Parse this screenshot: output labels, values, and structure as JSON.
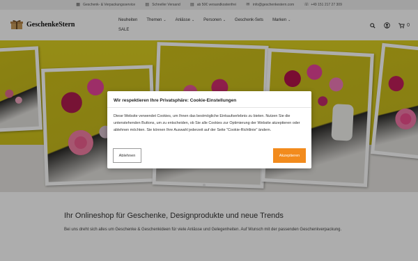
{
  "topbar": {
    "items": [
      {
        "icon": "gift-icon",
        "text": "Geschenk- & Verpackungsservice"
      },
      {
        "icon": "truck-icon",
        "text": "Schneller Versand"
      },
      {
        "icon": "truck-icon",
        "text": "ab 50€ versandkostenfrei"
      },
      {
        "icon": "mail-icon",
        "text": "info@geschenkestern.com"
      },
      {
        "icon": "phone-icon",
        "text": "+49 151 217 27 309"
      }
    ]
  },
  "header": {
    "logo_text": "GeschenkeStern",
    "nav": [
      {
        "label": "Neuheiten",
        "dropdown": false
      },
      {
        "label": "Themen",
        "dropdown": true
      },
      {
        "label": "Anlässe",
        "dropdown": true
      },
      {
        "label": "Personen",
        "dropdown": true
      },
      {
        "label": "Geschenk-Sets",
        "dropdown": false
      },
      {
        "label": "Marken",
        "dropdown": true
      },
      {
        "label": "SALE",
        "dropdown": false
      }
    ],
    "cart_count": "0",
    "icons": [
      "search-icon",
      "user-icon",
      "cart-icon"
    ]
  },
  "hero": {
    "slides": 2,
    "active_slide": 1
  },
  "intro": {
    "heading": "Ihr Onlineshop für Geschenke, Designprodukte und neue Trends",
    "text": "Bei uns dreht sich alles um Geschenke & Geschenkideen für viele Anlässe und Gelegenheiten. Auf Wunsch mit der passenden Geschenkverpackung."
  },
  "cookie": {
    "title": "Wir respektieren Ihre Privatsphäre: Cookie-Einstellungen",
    "body": "Diese Website verwendet Cookies, um Ihnen das bestmögliche Einkaufserlebnis zu bieten. Nutzen Sie die untenstehenden Buttons, um zu entscheiden, ob Sie alle Cookies zur Optimierung der Website akzeptieren oder ablehnen möchten. Sie können Ihre Auswahl jederzeit auf der Seite \"Cookie-Richtlinie\" ändern.",
    "decline_label": "Ablehnen",
    "accept_label": "Akzeptieren"
  },
  "colors": {
    "accent": "#f28b1d",
    "hero_wall": "#d5c91a"
  }
}
